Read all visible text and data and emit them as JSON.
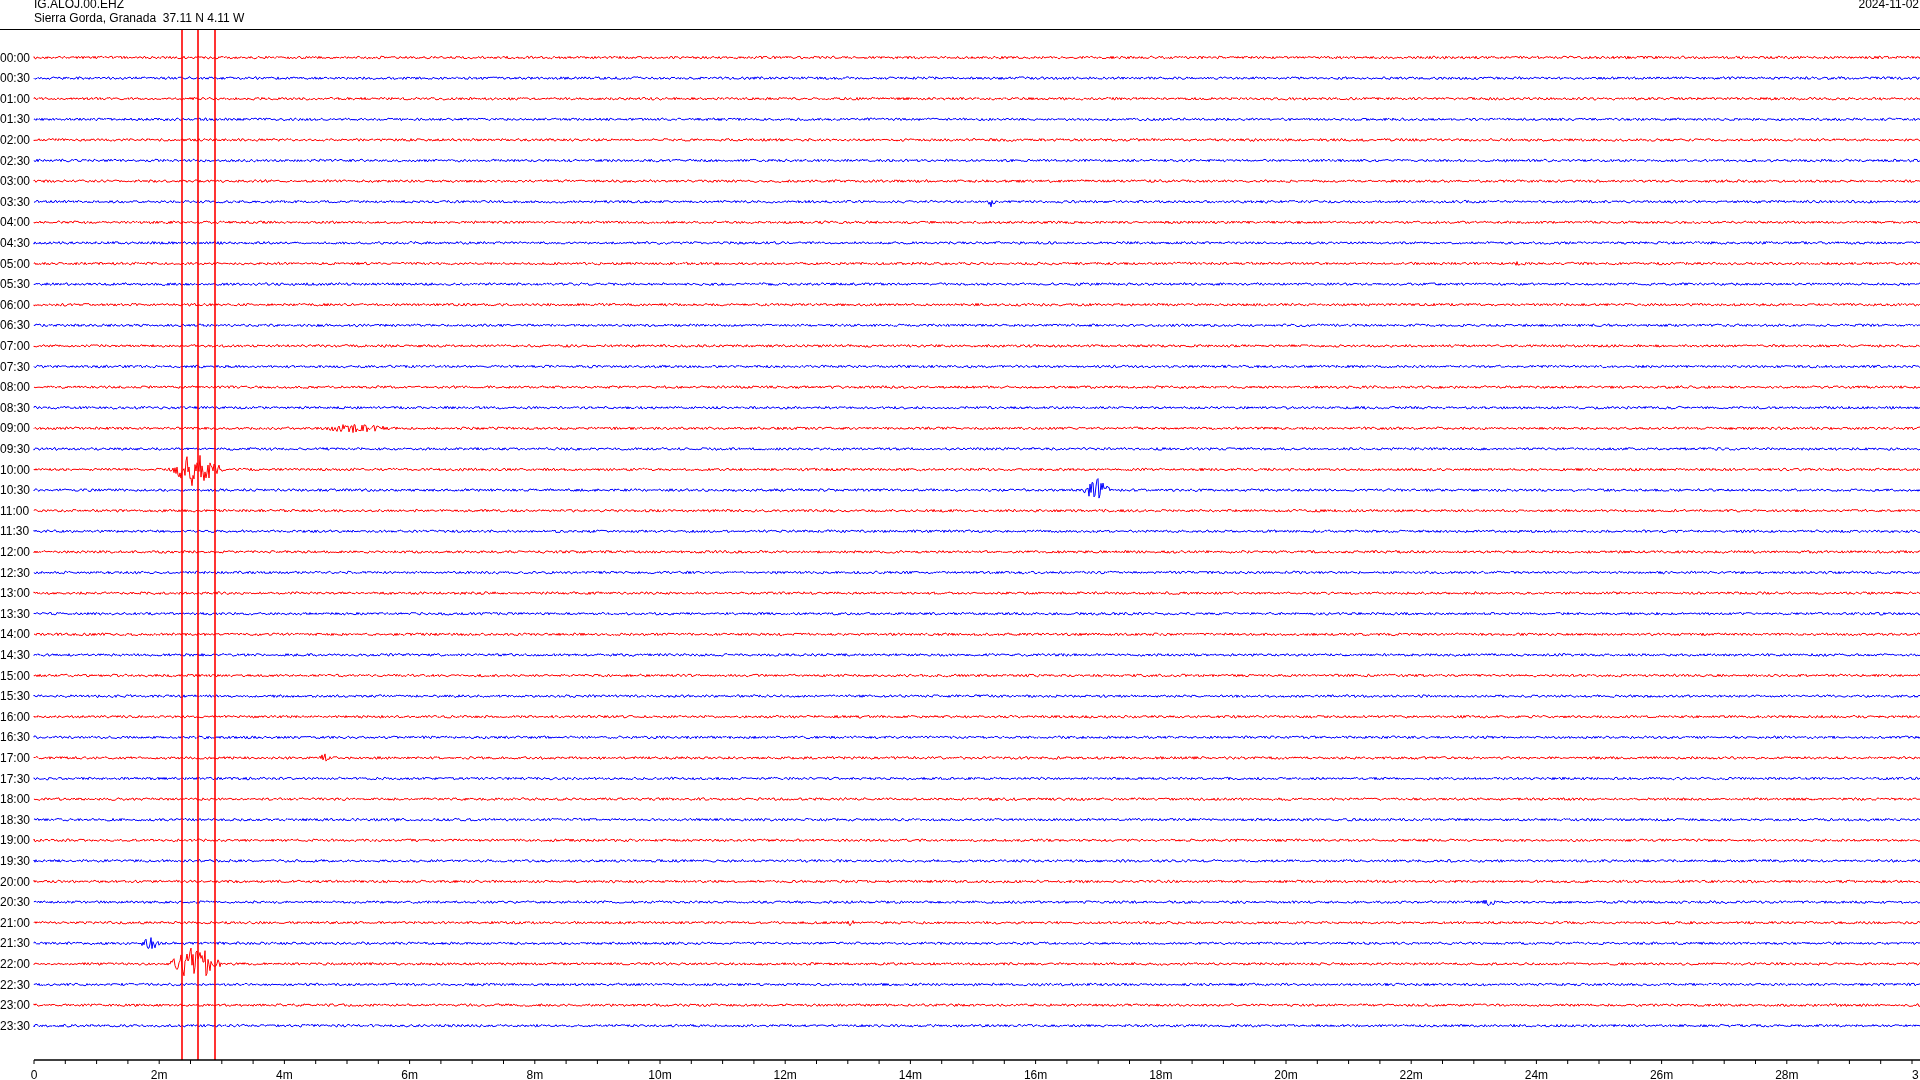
{
  "header": {
    "station": "IG.ALOJ.00.EHZ",
    "location": "Sierra Gorda, Granada  37.11 N 4.11 W",
    "date": "2024-11-02"
  },
  "rows": [
    {
      "time": "00:00",
      "color": "#ff0000"
    },
    {
      "time": "00:30",
      "color": "#0000ff"
    },
    {
      "time": "01:00",
      "color": "#ff0000"
    },
    {
      "time": "01:30",
      "color": "#0000ff"
    },
    {
      "time": "02:00",
      "color": "#ff0000"
    },
    {
      "time": "02:30",
      "color": "#0000ff"
    },
    {
      "time": "03:00",
      "color": "#ff0000"
    },
    {
      "time": "03:30",
      "color": "#0000ff"
    },
    {
      "time": "04:00",
      "color": "#ff0000"
    },
    {
      "time": "04:30",
      "color": "#0000ff"
    },
    {
      "time": "05:00",
      "color": "#ff0000"
    },
    {
      "time": "05:30",
      "color": "#0000ff"
    },
    {
      "time": "06:00",
      "color": "#ff0000"
    },
    {
      "time": "06:30",
      "color": "#0000ff"
    },
    {
      "time": "07:00",
      "color": "#ff0000"
    },
    {
      "time": "07:30",
      "color": "#0000ff"
    },
    {
      "time": "08:00",
      "color": "#ff0000"
    },
    {
      "time": "08:30",
      "color": "#0000ff"
    },
    {
      "time": "09:00",
      "color": "#ff0000"
    },
    {
      "time": "09:30",
      "color": "#0000ff"
    },
    {
      "time": "10:00",
      "color": "#ff0000"
    },
    {
      "time": "10:30",
      "color": "#0000ff"
    },
    {
      "time": "11:00",
      "color": "#ff0000"
    },
    {
      "time": "11:30",
      "color": "#0000ff"
    },
    {
      "time": "12:00",
      "color": "#ff0000"
    },
    {
      "time": "12:30",
      "color": "#0000ff"
    },
    {
      "time": "13:00",
      "color": "#ff0000"
    },
    {
      "time": "13:30",
      "color": "#0000ff"
    },
    {
      "time": "14:00",
      "color": "#ff0000"
    },
    {
      "time": "14:30",
      "color": "#0000ff"
    },
    {
      "time": "15:00",
      "color": "#ff0000"
    },
    {
      "time": "15:30",
      "color": "#0000ff"
    },
    {
      "time": "16:00",
      "color": "#ff0000"
    },
    {
      "time": "16:30",
      "color": "#0000ff"
    },
    {
      "time": "17:00",
      "color": "#ff0000"
    },
    {
      "time": "17:30",
      "color": "#0000ff"
    },
    {
      "time": "18:00",
      "color": "#ff0000"
    },
    {
      "time": "18:30",
      "color": "#0000ff"
    },
    {
      "time": "19:00",
      "color": "#ff0000"
    },
    {
      "time": "19:30",
      "color": "#0000ff"
    },
    {
      "time": "20:00",
      "color": "#ff0000"
    },
    {
      "time": "20:30",
      "color": "#0000ff"
    },
    {
      "time": "21:00",
      "color": "#ff0000"
    },
    {
      "time": "21:30",
      "color": "#0000ff"
    },
    {
      "time": "22:00",
      "color": "#ff0000"
    },
    {
      "time": "22:30",
      "color": "#0000ff"
    },
    {
      "time": "23:00",
      "color": "#ff0000"
    },
    {
      "time": "23:30",
      "color": "#0000ff"
    }
  ],
  "x_axis": {
    "ticks": [
      "0",
      "2m",
      "4m",
      "6m",
      "8m",
      "10m",
      "12m",
      "14m",
      "16m",
      "18m",
      "20m",
      "22m",
      "24m",
      "26m",
      "28m",
      "3"
    ]
  }
}
